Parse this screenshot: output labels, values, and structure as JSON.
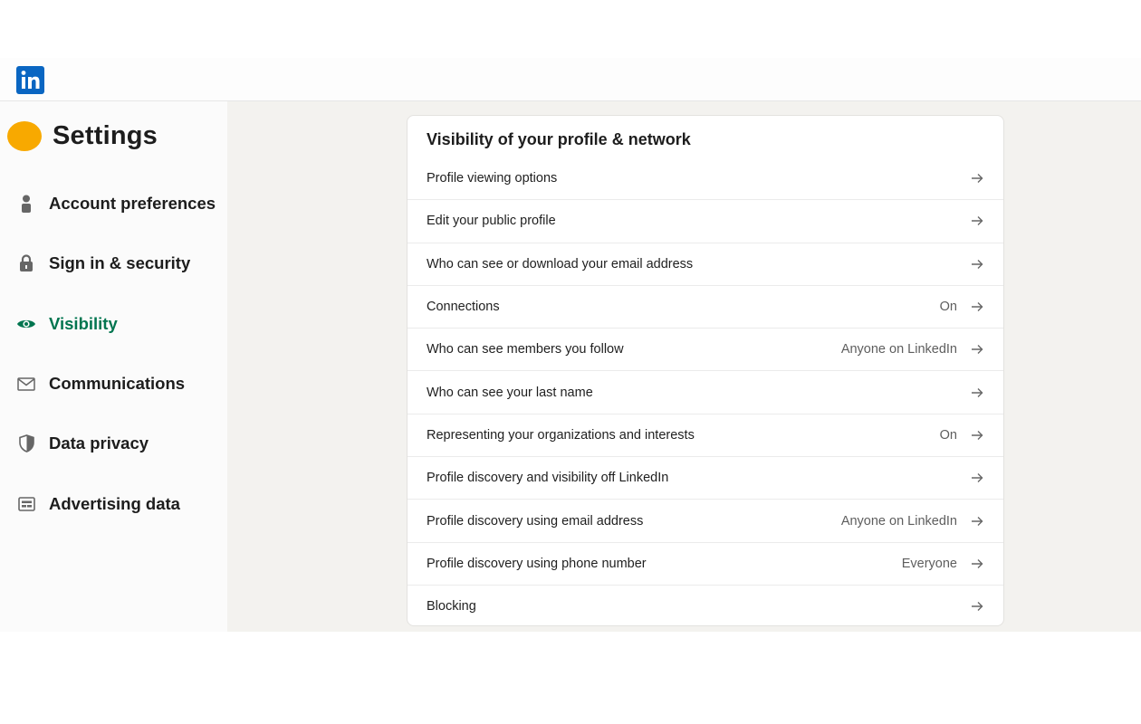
{
  "header": {
    "logo_icon": "linkedin-logo",
    "logo_text": "in"
  },
  "sidebar": {
    "title": "Settings",
    "avatar_color": "#f8a900",
    "items": [
      {
        "label": "Account preferences",
        "icon": "person-icon",
        "active": false
      },
      {
        "label": "Sign in & security",
        "icon": "lock-icon",
        "active": false
      },
      {
        "label": "Visibility",
        "icon": "eye-icon",
        "active": true
      },
      {
        "label": "Communications",
        "icon": "envelope-icon",
        "active": false
      },
      {
        "label": "Data privacy",
        "icon": "shield-icon",
        "active": false
      },
      {
        "label": "Advertising data",
        "icon": "ad-icon",
        "active": false
      }
    ],
    "active_color": "#01754f"
  },
  "card": {
    "title": "Visibility of your profile & network",
    "rows": [
      {
        "label": "Profile viewing options",
        "value": ""
      },
      {
        "label": "Edit your public profile",
        "value": ""
      },
      {
        "label": "Who can see or download your email address",
        "value": ""
      },
      {
        "label": "Connections",
        "value": "On"
      },
      {
        "label": "Who can see members you follow",
        "value": "Anyone on LinkedIn"
      },
      {
        "label": "Who can see your last name",
        "value": ""
      },
      {
        "label": "Representing your organizations and interests",
        "value": "On"
      },
      {
        "label": "Profile discovery and visibility off LinkedIn",
        "value": ""
      },
      {
        "label": "Profile discovery using email address",
        "value": "Anyone on LinkedIn"
      },
      {
        "label": "Profile discovery using phone number",
        "value": "Everyone"
      },
      {
        "label": "Blocking",
        "value": ""
      }
    ],
    "arrow_icon": "arrow-right-icon"
  },
  "colors": {
    "brand": "#0a66c2",
    "background": "#f3f2ef"
  }
}
